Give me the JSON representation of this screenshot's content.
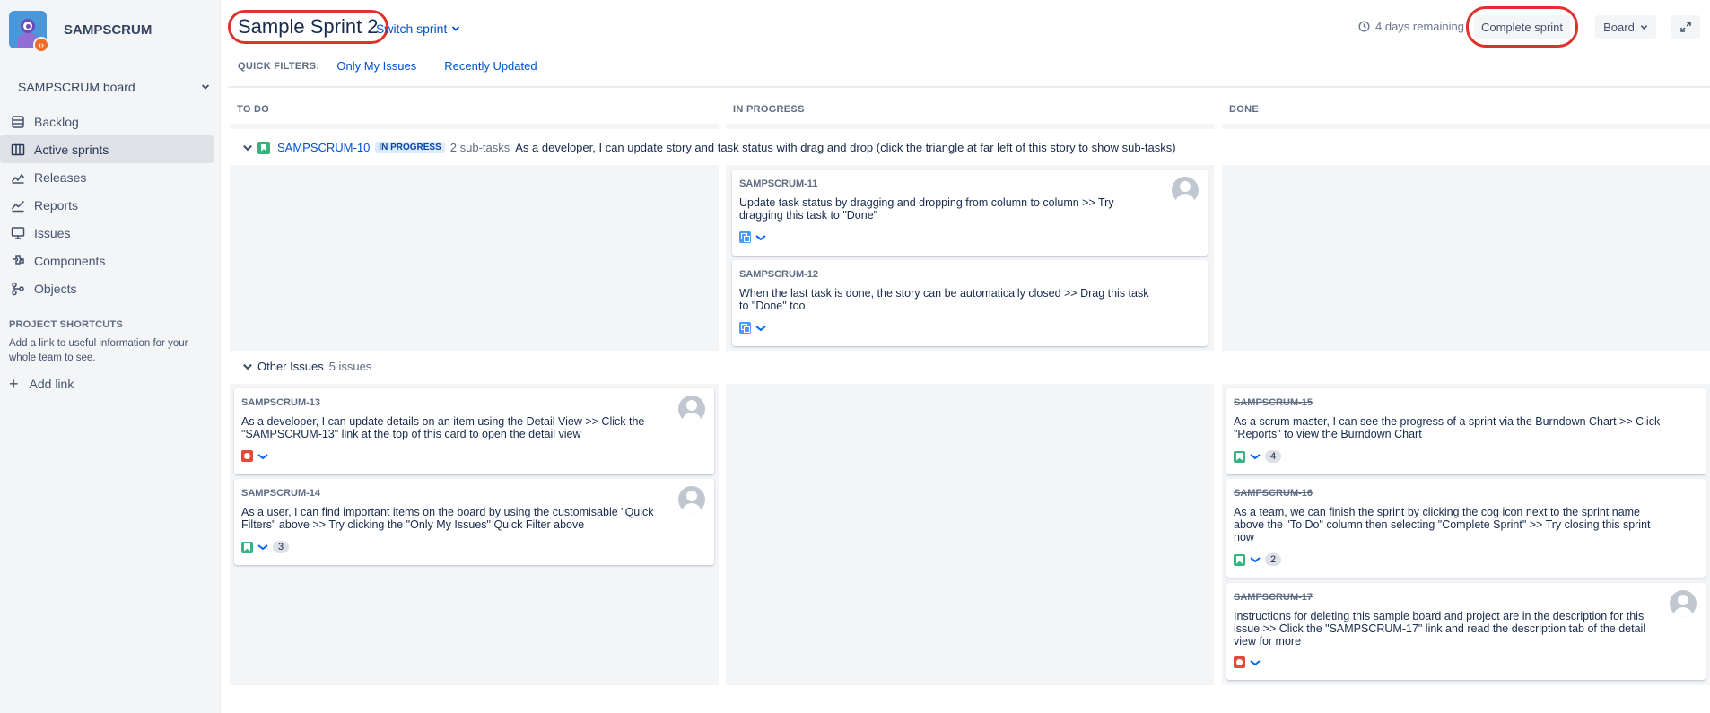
{
  "project": {
    "name": "SAMPSCRUM"
  },
  "sidebar": {
    "board_selector": "SAMPSCRUM board",
    "items": [
      {
        "label": "Backlog",
        "icon": "backlog-icon"
      },
      {
        "label": "Active sprints",
        "icon": "board-icon",
        "active": true
      },
      {
        "label": "Releases",
        "icon": "releases-icon"
      },
      {
        "label": "Reports",
        "icon": "reports-icon"
      },
      {
        "label": "Issues",
        "icon": "issues-icon"
      },
      {
        "label": "Components",
        "icon": "components-icon"
      },
      {
        "label": "Objects",
        "icon": "objects-icon"
      }
    ],
    "shortcuts_title": "PROJECT SHORTCUTS",
    "shortcuts_desc": "Add a link to useful information for your whole team to see.",
    "add_link": "Add link"
  },
  "header": {
    "sprint_title": "Sample Sprint 2",
    "switch_sprint": "Switch sprint",
    "remaining": "4 days remaining",
    "complete_sprint": "Complete sprint",
    "board_menu": "Board"
  },
  "quick_filters": {
    "label": "QUICK FILTERS:",
    "filters": [
      "Only My Issues",
      "Recently Updated"
    ]
  },
  "columns": [
    "TO DO",
    "IN PROGRESS",
    "DONE"
  ],
  "swimlanes": {
    "story": {
      "key": "SAMPSCRUM-10",
      "status": "IN PROGRESS",
      "subtasks": "2 sub-tasks",
      "summary": "As a developer, I can update story and task status with drag and drop (click the triangle at far left of this story to show sub-tasks)"
    },
    "other": {
      "label": "Other Issues",
      "count": "5 issues"
    }
  },
  "cards": {
    "s11": {
      "key": "SAMPSCRUM-11",
      "summary": "Update task status by dragging and dropping from column to column >> Try dragging this task to \"Done\"",
      "type": "subtask-icon"
    },
    "s12": {
      "key": "SAMPSCRUM-12",
      "summary": "When the last task is done, the story can be automatically closed >> Drag this task to \"Done\" too",
      "type": "subtask-icon"
    },
    "s13": {
      "key": "SAMPSCRUM-13",
      "summary": "As a developer, I can update details on an item using the Detail View >> Click the \"SAMPSCRUM-13\" link at the top of this card to open the detail view",
      "type": "bug-icon"
    },
    "s14": {
      "key": "SAMPSCRUM-14",
      "summary": "As a user, I can find important items on the board by using the customisable \"Quick Filters\" above >> Try clicking the \"Only My Issues\" Quick Filter above",
      "type": "story-icon",
      "points": "3"
    },
    "s15": {
      "key": "SAMPSCRUM-15",
      "summary": "As a scrum master, I can see the progress of a sprint via the Burndown Chart >> Click \"Reports\" to view the Burndown Chart",
      "type": "story-icon",
      "points": "4"
    },
    "s16": {
      "key": "SAMPSCRUM-16",
      "summary": "As a team, we can finish the sprint by clicking the cog icon next to the sprint name above the \"To Do\" column then selecting \"Complete Sprint\" >> Try closing this sprint now",
      "type": "story-icon",
      "points": "2"
    },
    "s17": {
      "key": "SAMPSCRUM-17",
      "summary": "Instructions for deleting this sample board and project are in the description for this issue >> Click the \"SAMPSCRUM-17\" link and read the description tab of the detail view for more",
      "type": "bug-icon"
    }
  },
  "colors": {
    "accent": "#0052cc",
    "highlight_ring": "#e0322d",
    "story": "#36b37e",
    "bug": "#e5493a",
    "subtask": "#4c9aff"
  }
}
